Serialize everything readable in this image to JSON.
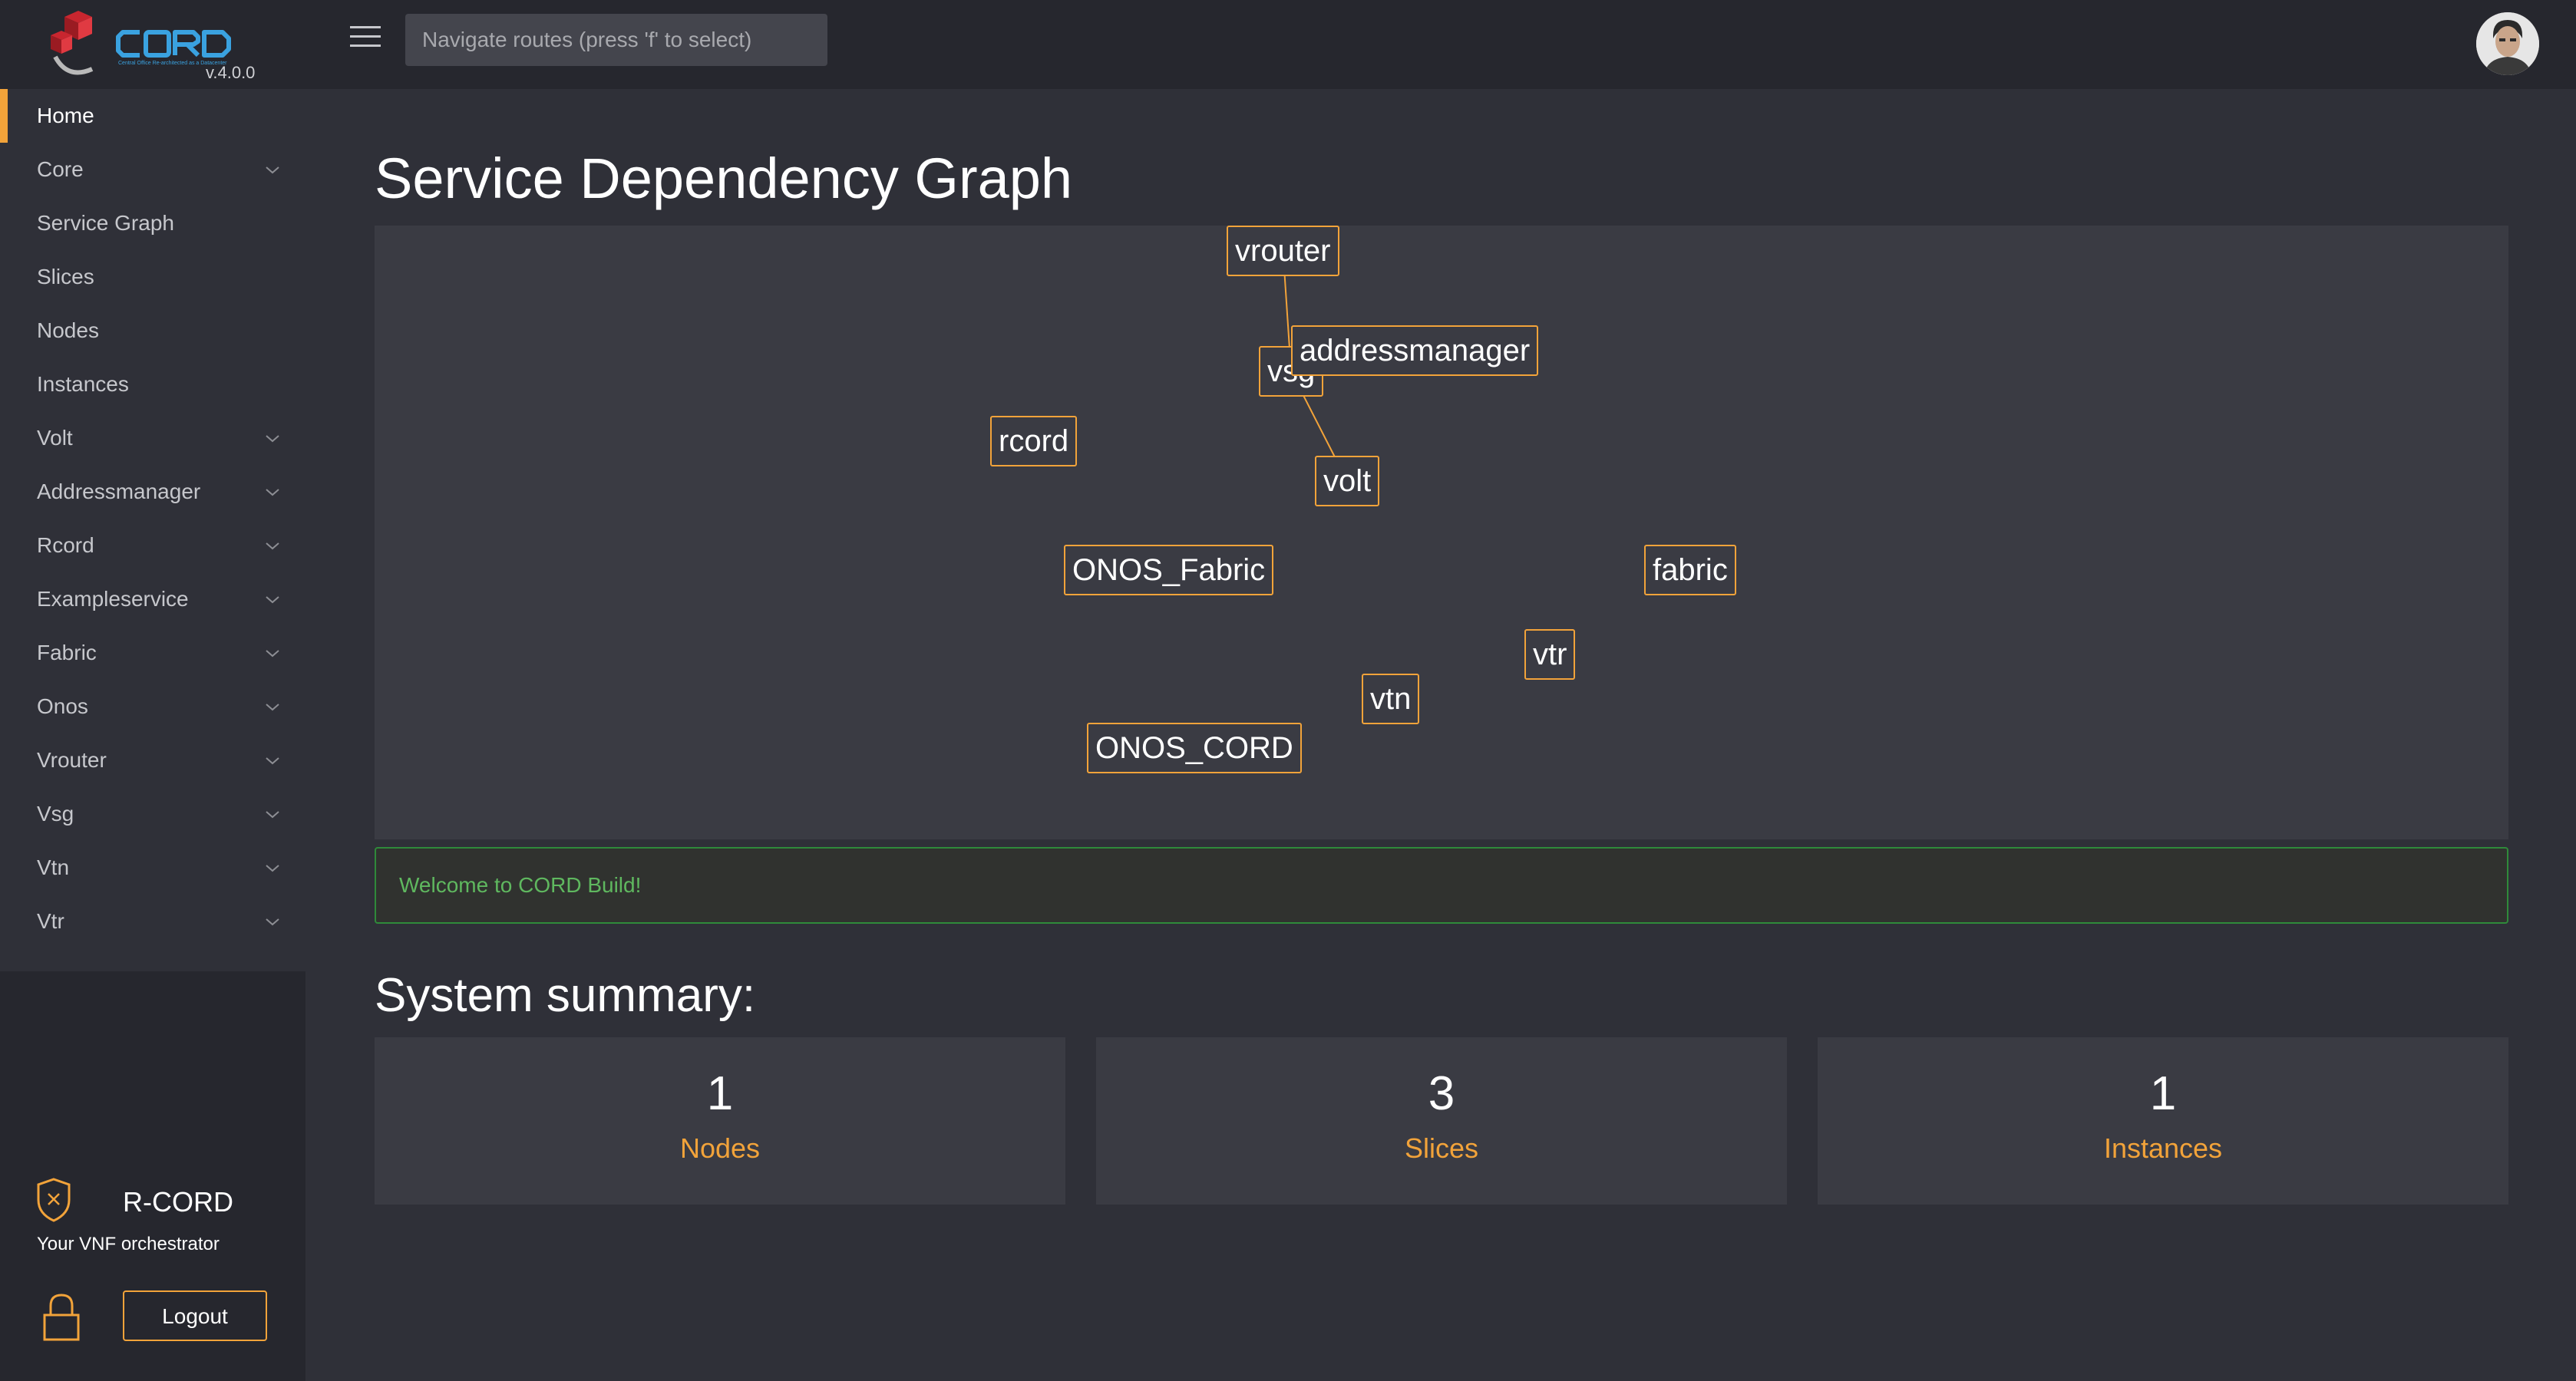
{
  "brand": {
    "name": "CORD",
    "tagline": "Central Office Re-architected as a Datacenter",
    "version": "v.4.0.0"
  },
  "topbar": {
    "search_placeholder": "Navigate routes (press 'f' to select)"
  },
  "sidebar": {
    "items": [
      {
        "label": "Home",
        "active": true,
        "expandable": false
      },
      {
        "label": "Core",
        "active": false,
        "expandable": true
      },
      {
        "label": "Service Graph",
        "active": false,
        "expandable": false
      },
      {
        "label": "Slices",
        "active": false,
        "expandable": false
      },
      {
        "label": "Nodes",
        "active": false,
        "expandable": false
      },
      {
        "label": "Instances",
        "active": false,
        "expandable": false
      },
      {
        "label": "Volt",
        "active": false,
        "expandable": true
      },
      {
        "label": "Addressmanager",
        "active": false,
        "expandable": true
      },
      {
        "label": "Rcord",
        "active": false,
        "expandable": true
      },
      {
        "label": "Exampleservice",
        "active": false,
        "expandable": true
      },
      {
        "label": "Fabric",
        "active": false,
        "expandable": true
      },
      {
        "label": "Onos",
        "active": false,
        "expandable": true
      },
      {
        "label": "Vrouter",
        "active": false,
        "expandable": true
      },
      {
        "label": "Vsg",
        "active": false,
        "expandable": true
      },
      {
        "label": "Vtn",
        "active": false,
        "expandable": true
      },
      {
        "label": "Vtr",
        "active": false,
        "expandable": true
      }
    ],
    "footer": {
      "title": "R-CORD",
      "subtitle": "Your VNF orchestrator",
      "logout_label": "Logout"
    }
  },
  "main": {
    "title": "Service Dependency Graph",
    "graph": {
      "nodes": [
        "vrouter",
        "vsg",
        "addressmanager",
        "rcord",
        "volt",
        "ONOS_Fabric",
        "fabric",
        "vtr",
        "vtn",
        "ONOS_CORD"
      ],
      "edges": [
        {
          "from": "vrouter",
          "to": "vsg"
        },
        {
          "from": "vsg",
          "to": "volt"
        }
      ]
    },
    "welcome": "Welcome to CORD Build!",
    "summary_title": "System summary:",
    "summary": [
      {
        "value": "1",
        "label": "Nodes"
      },
      {
        "value": "3",
        "label": "Slices"
      },
      {
        "value": "1",
        "label": "Instances"
      }
    ]
  },
  "colors": {
    "accent": "#f2a33a",
    "background": "#2f3038",
    "panel": "#3a3b43",
    "sidebar": "#26272e",
    "success": "#5fb85f"
  }
}
